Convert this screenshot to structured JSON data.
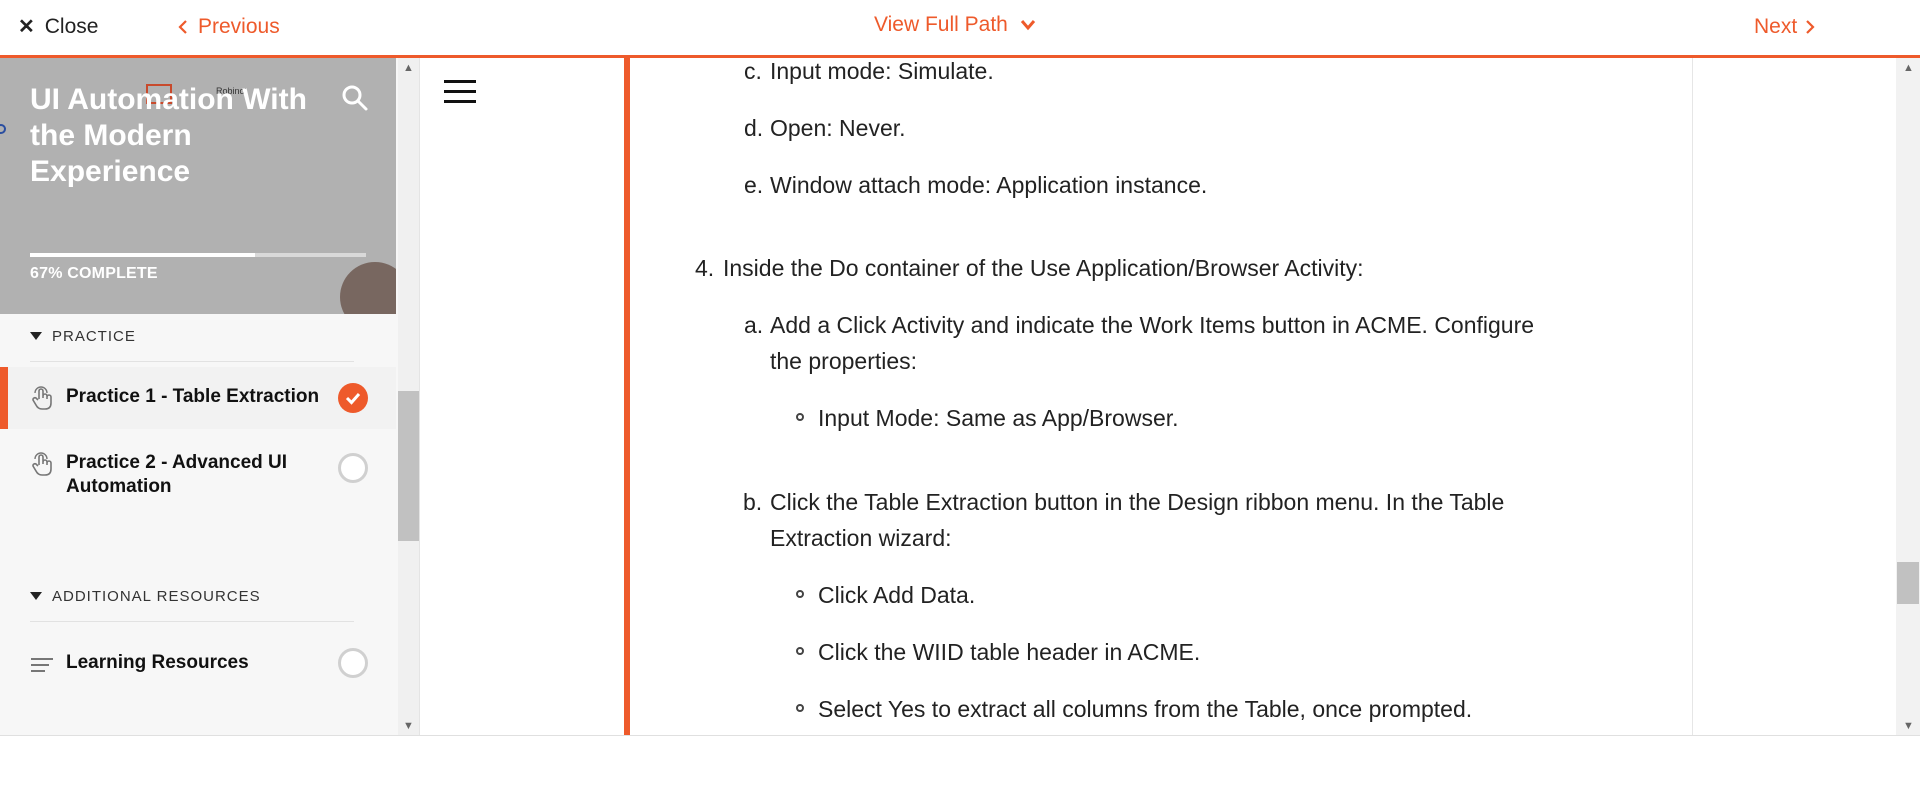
{
  "topbar": {
    "close_label": "Close",
    "previous_label": "Previous",
    "view_path_label": "View Full Path",
    "next_label": "Next"
  },
  "sidebar": {
    "course_title": "UI Automation With the Modern Experience",
    "progress_percent": 67,
    "progress_label": "67% COMPLETE",
    "sections": [
      {
        "title": "PRACTICE",
        "items": [
          {
            "label": "Practice 1 - Table Extraction",
            "icon": "touch-icon",
            "status": "complete",
            "active": true
          },
          {
            "label": "Practice 2 - Advanced UI Automation",
            "icon": "touch-icon",
            "status": "incomplete",
            "active": false
          }
        ]
      },
      {
        "title": "ADDITIONAL RESOURCES",
        "items": [
          {
            "label": "Learning Resources",
            "icon": "lines-icon",
            "status": "incomplete",
            "active": false
          }
        ]
      }
    ]
  },
  "content": {
    "lines": [
      {
        "marker": "c.",
        "text": "Input mode: Simulate."
      },
      {
        "marker": "d.",
        "text": "Open: Never."
      },
      {
        "marker": "e.",
        "text": "Window attach mode: Application instance."
      },
      {
        "marker": "4.",
        "text": "Inside the Do container of the Use Application/Browser Activity:"
      },
      {
        "marker": "a.",
        "text": "Add a Click Activity and indicate the Work Items button in ACME. Configure",
        "cont": "the properties:"
      },
      {
        "marker": "bullet",
        "text": "Input Mode: Same as App/Browser."
      },
      {
        "marker": "b.",
        "text": "Click the Table Extraction button in the Design ribbon menu. In the Table",
        "cont": "Extraction wizard:"
      },
      {
        "marker": "bullet",
        "text": "Click Add Data."
      },
      {
        "marker": "bullet",
        "text": "Click the WIID table header in ACME."
      },
      {
        "marker": "bullet",
        "text": "Select Yes to extract all columns from the Table, once prompted."
      }
    ]
  },
  "colors": {
    "accent": "#ee5a2b",
    "hero_bg": "#b1b1b1",
    "sidebar_bg": "#f7f7f7"
  }
}
